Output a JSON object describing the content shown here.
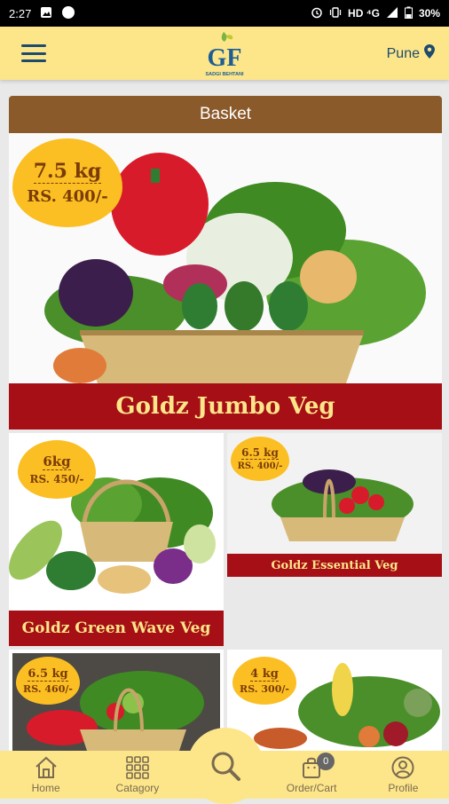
{
  "status_bar": {
    "time": "2:27",
    "network": "HD ⁴G",
    "battery": "30%"
  },
  "header": {
    "location": "Pune"
  },
  "section": {
    "title": "Basket"
  },
  "baskets": [
    {
      "name": "Goldz Jumbo Veg",
      "weight": "7.5 kg",
      "price": "RS. 400/-"
    },
    {
      "name": "Goldz Green Wave Veg",
      "weight": "6kg",
      "price": "RS. 450/-"
    },
    {
      "name": "Goldz Essential Veg",
      "weight": "6.5 kg",
      "price": "RS. 400/-"
    },
    {
      "name": "",
      "weight": "6.5 kg",
      "price": "RS. 460/-"
    },
    {
      "name": "",
      "weight": "4 kg",
      "price": "RS. 300/-"
    }
  ],
  "bottom_nav": {
    "home": "Home",
    "category": "Catagory",
    "cart": "Order/Cart",
    "cart_count": "0",
    "profile": "Profile"
  },
  "colors": {
    "accent": "#fde68a",
    "brown": "#8b5a2b",
    "red_band": "#a50f15",
    "badge": "#fbbf24"
  }
}
